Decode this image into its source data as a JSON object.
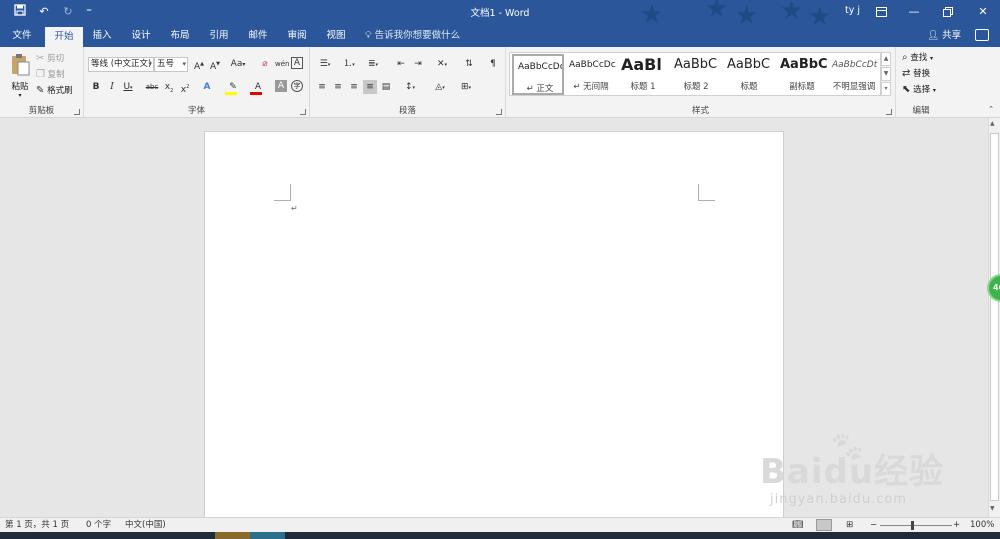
{
  "titlebar": {
    "title": "文档1 - Word",
    "user": "ty j"
  },
  "tabs": [
    "文件",
    "开始",
    "插入",
    "设计",
    "布局",
    "引用",
    "邮件",
    "审阅",
    "视图"
  ],
  "active_tab": "开始",
  "tell_me": "告诉我你想要做什么",
  "share": "共享",
  "clipboard": {
    "paste": "粘贴",
    "cut": "剪切",
    "copy": "复制",
    "format_painter": "格式刷",
    "label": "剪贴板"
  },
  "font": {
    "font_name": "等线 (中文正文)",
    "font_size": "五号",
    "change_case": "Aa",
    "label": "字体"
  },
  "paragraph": {
    "label": "段落"
  },
  "styles": {
    "items": [
      {
        "preview": "AaBbCcDc",
        "name": "正文"
      },
      {
        "preview": "AaBbCcDc",
        "name": "无间隔"
      },
      {
        "preview": "AaBl",
        "name": "标题 1"
      },
      {
        "preview": "AaBbC",
        "name": "标题 2"
      },
      {
        "preview": "AaBbC",
        "name": "标题"
      },
      {
        "preview": "AaBbC",
        "name": "副标题"
      },
      {
        "preview": "AaBbCcDt",
        "name": "不明显强调"
      }
    ],
    "label": "样式"
  },
  "editing": {
    "find": "查找",
    "replace": "替换",
    "select": "选择",
    "label": "编辑"
  },
  "statusbar": {
    "page": "第 1 页，共 1 页",
    "words": "0 个字",
    "language": "中文(中国)",
    "zoom": "100%"
  },
  "badge": "46",
  "watermark": {
    "logo": "Baidu经验",
    "url": "jingyan.baidu.com"
  },
  "colors": {
    "brand": "#2b579a",
    "highlight": "#ffff00",
    "font_color": "#e00000"
  }
}
